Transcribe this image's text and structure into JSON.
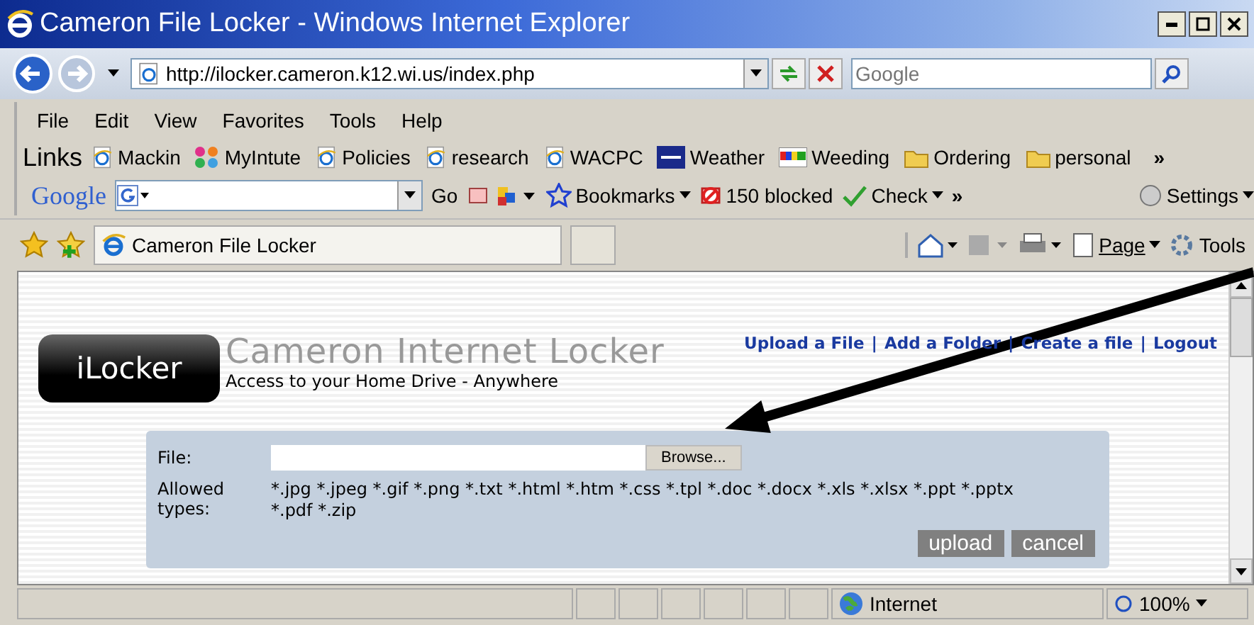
{
  "window": {
    "title": "Cameron File Locker - Windows Internet Explorer"
  },
  "address_bar": {
    "url": "http://ilocker.cameron.k12.wi.us/index.php"
  },
  "search": {
    "placeholder": "Google"
  },
  "menu": [
    "File",
    "Edit",
    "View",
    "Favorites",
    "Tools",
    "Help"
  ],
  "links_bar": {
    "label": "Links",
    "items": [
      {
        "label": "Mackin",
        "kind": "page"
      },
      {
        "label": "MyIntute",
        "kind": "dots"
      },
      {
        "label": "Policies",
        "kind": "page"
      },
      {
        "label": "research",
        "kind": "page"
      },
      {
        "label": "WACPC",
        "kind": "page"
      },
      {
        "label": "Weather",
        "kind": "twc"
      },
      {
        "label": "Weeding",
        "kind": "bars"
      },
      {
        "label": "Ordering",
        "kind": "folder"
      },
      {
        "label": "personal",
        "kind": "folder"
      }
    ],
    "more": "»"
  },
  "google_toolbar": {
    "logo": "Google",
    "go": "Go",
    "bookmarks": "Bookmarks",
    "blocked": "150 blocked",
    "check": "Check",
    "more": "»",
    "settings": "Settings"
  },
  "tab": {
    "title": "Cameron File Locker"
  },
  "command_bar": {
    "page": "Page",
    "tools": "Tools"
  },
  "page": {
    "logo": "iLocker",
    "title": "Cameron Internet Locker",
    "subtitle": "Access to your Home Drive - Anywhere",
    "nav": [
      "Upload a File",
      "Add a Folder",
      "Create a file",
      "Logout"
    ],
    "nav_separator": "|",
    "form": {
      "file_label": "File:",
      "browse": "Browse...",
      "allowed_label": "Allowed types:",
      "allowed_types": "*.jpg *.jpeg *.gif *.png *.txt *.html *.htm *.css *.tpl *.doc *.docx *.xls *.xlsx *.ppt *.pptx *.pdf *.zip",
      "buttons": [
        "upload",
        "cancel"
      ]
    }
  },
  "status_bar": {
    "zone": "Internet",
    "zoom": "100%"
  }
}
